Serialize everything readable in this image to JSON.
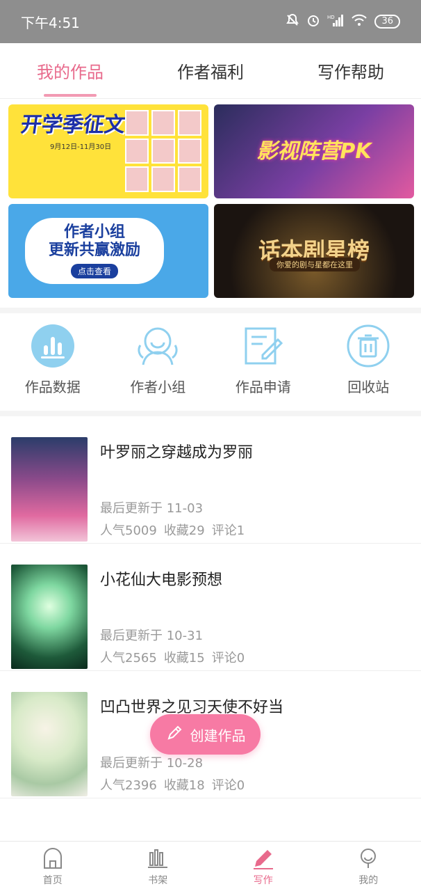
{
  "status_bar": {
    "time": "下午4:51",
    "network": "HD",
    "battery": "36"
  },
  "tabs": [
    {
      "label": "我的作品",
      "active": true
    },
    {
      "label": "作者福利",
      "active": false
    },
    {
      "label": "写作帮助",
      "active": false
    }
  ],
  "banners": [
    {
      "title": "开学季征文",
      "subtitle": "9月12日-11月30日"
    },
    {
      "title": "影视阵营PK"
    },
    {
      "title": "作者小组\n更新共赢激励",
      "button": "点击查看"
    },
    {
      "title": "话本剧星榜",
      "subtitle": "你爱的剧与星都在这里"
    }
  ],
  "quick_actions": [
    {
      "label": "作品数据",
      "icon": "bar-chart-icon"
    },
    {
      "label": "作者小组",
      "icon": "group-icon"
    },
    {
      "label": "作品申请",
      "icon": "edit-document-icon"
    },
    {
      "label": "回收站",
      "icon": "trash-icon"
    }
  ],
  "works": [
    {
      "title": "叶罗丽之穿越成为罗丽",
      "updated": "最后更新于 11-03",
      "popularity": "人气5009",
      "favorites": "收藏29",
      "comments": "评论1"
    },
    {
      "title": "小花仙大电影预想",
      "updated": "最后更新于 10-31",
      "popularity": "人气2565",
      "favorites": "收藏15",
      "comments": "评论0"
    },
    {
      "title": "凹凸世界之见习天使不好当",
      "updated": "最后更新于 10-28",
      "popularity": "人气2396",
      "favorites": "收藏18",
      "comments": "评论0"
    }
  ],
  "fab": {
    "label": "创建作品"
  },
  "bottom_nav": [
    {
      "label": "首页",
      "icon": "home-icon",
      "active": false
    },
    {
      "label": "书架",
      "icon": "bookshelf-icon",
      "active": false
    },
    {
      "label": "写作",
      "icon": "pencil-icon",
      "active": true
    },
    {
      "label": "我的",
      "icon": "profile-icon",
      "active": false
    }
  ],
  "colors": {
    "accent": "#e86a8c",
    "fab": "#f77aa4",
    "icon_blue": "#8fd0ef"
  }
}
